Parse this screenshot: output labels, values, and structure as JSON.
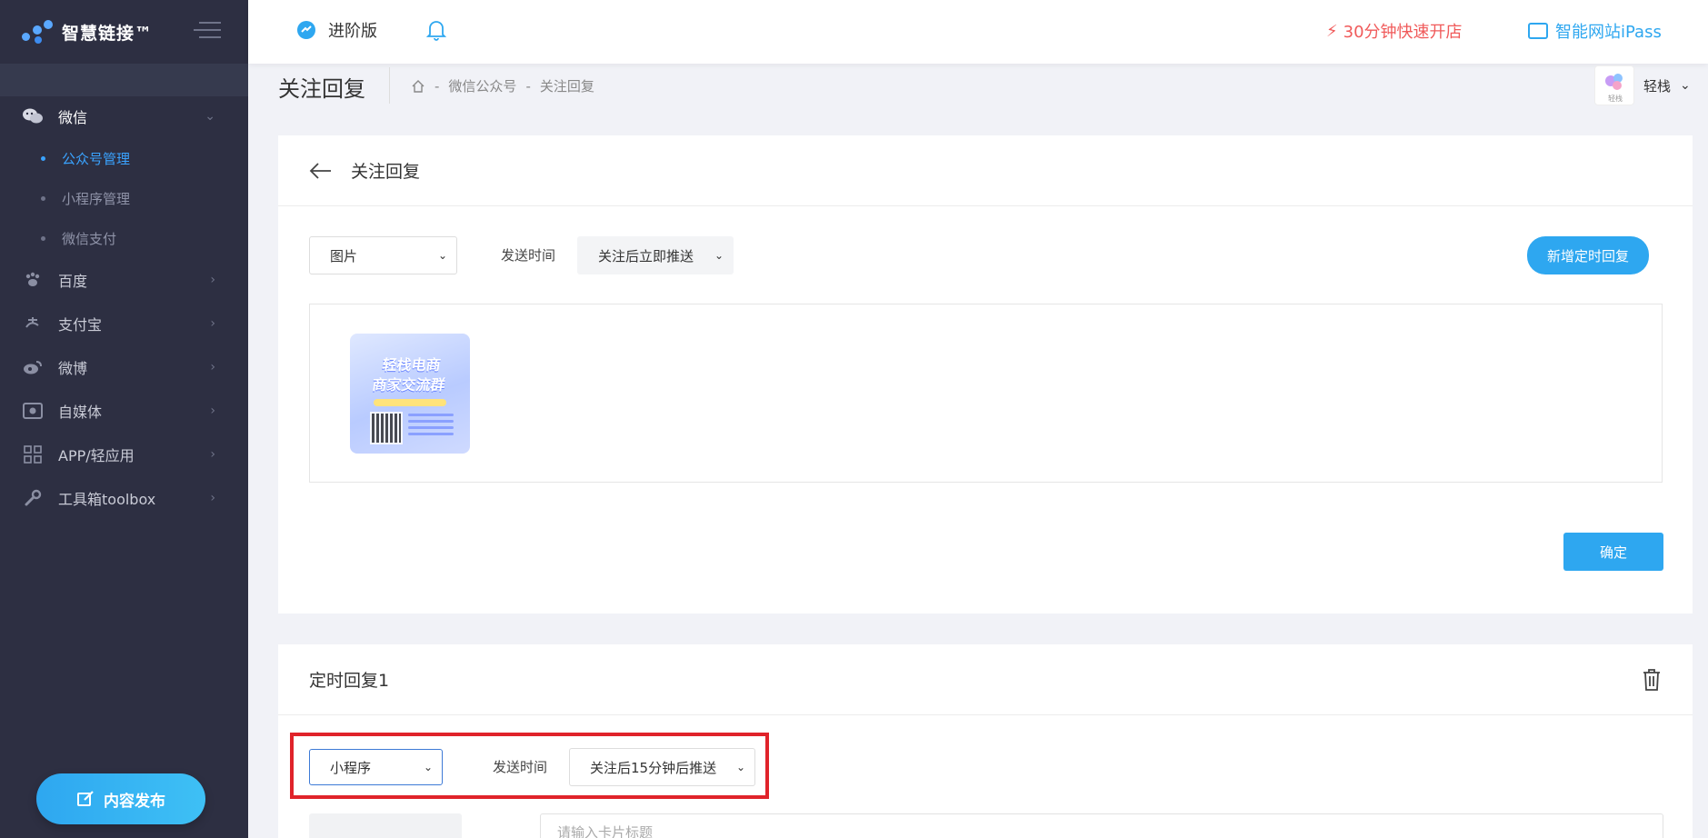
{
  "brand": {
    "name": "智慧链接™"
  },
  "topbar": {
    "edition": "进阶版",
    "quick_open": "30分钟快速开店",
    "ipass": "智能网站iPass"
  },
  "sidebar": {
    "items": [
      {
        "label": "微信",
        "icon": "wechat-icon",
        "expanded": true
      },
      {
        "label": "百度",
        "icon": "paw-icon"
      },
      {
        "label": "支付宝",
        "icon": "alipay-icon"
      },
      {
        "label": "微博",
        "icon": "weibo-icon"
      },
      {
        "label": "自媒体",
        "icon": "media-icon"
      },
      {
        "label": "APP/轻应用",
        "icon": "app-grid-icon"
      },
      {
        "label": "工具箱toolbox",
        "icon": "wrench-icon"
      }
    ],
    "wechat_sub": [
      "公众号管理",
      "小程序管理",
      "微信支付"
    ],
    "publish_label": "内容发布"
  },
  "page": {
    "title": "关注回复",
    "breadcrumb": [
      "微信公众号",
      "关注回复"
    ],
    "user_name": "轻栈",
    "avatar_caption": "轻栈"
  },
  "card1": {
    "heading": "关注回复",
    "type_value": "图片",
    "send_time_label": "发送时间",
    "send_time_value": "关注后立即推送",
    "add_button": "新增定时回复",
    "confirm_button": "确定",
    "poster": {
      "title_line1": "轻栈电商",
      "title_line2": "商家交流群"
    }
  },
  "card2": {
    "heading": "定时回复1",
    "type_value": "小程序",
    "send_time_label": "发送时间",
    "send_time_value": "关注后15分钟后推送",
    "title_placeholder": "请输入卡片标题"
  },
  "colors": {
    "sidebar_bg": "#2d2f42",
    "accent": "#2ea7f0",
    "danger": "#f05a5a",
    "highlight": "#e0232a"
  }
}
